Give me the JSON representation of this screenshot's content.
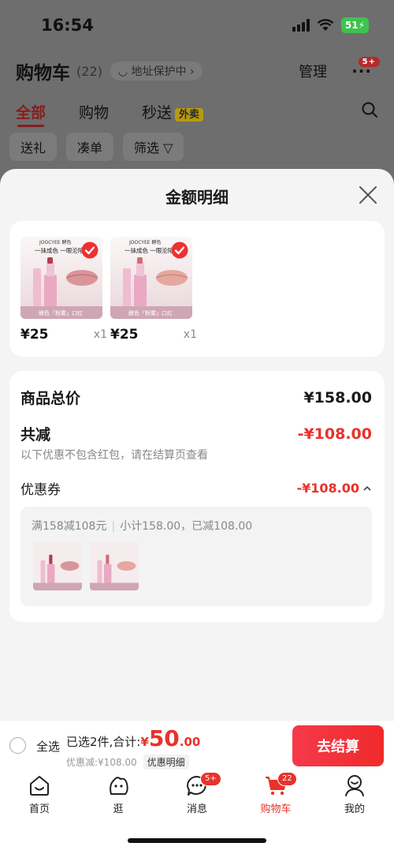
{
  "status": {
    "time": "16:54",
    "battery": "51"
  },
  "header": {
    "title": "购物车",
    "count": "(22)",
    "address_protect": "地址保护中",
    "manage": "管理",
    "more_badge": "5+"
  },
  "tabs": [
    {
      "label": "全部"
    },
    {
      "label": "购物"
    },
    {
      "label": "秒送"
    }
  ],
  "waimai_tag": "外卖",
  "filters": [
    "送礼",
    "凑单",
    "筛选"
  ],
  "sheet": {
    "title": "金额明细",
    "products": [
      {
        "brand": "JOOCYEE 酵色",
        "slogan": "一抹成色 一眼沦陷",
        "caption": "酵色「粉雾」口红",
        "price": "¥25",
        "qty": "x1"
      },
      {
        "brand": "JOOCYEE 酵色",
        "slogan": "一抹成色 一眼沦陷",
        "caption": "酵色「粉雾」口红",
        "price": "¥25",
        "qty": "x1"
      }
    ],
    "total_label": "商品总价",
    "total_value": "¥158.00",
    "reduce_label": "共减",
    "reduce_value": "-¥108.00",
    "reduce_note": "以下优惠不包含红包，请在结算页查看",
    "coupon_label": "优惠券",
    "coupon_value": "-¥108.00",
    "coupon_rule": "满158减108元",
    "coupon_detail": "小计158.00，已减108.00"
  },
  "checkout": {
    "select_all": "全选",
    "summary": "已选2件,合计:",
    "currency": "¥",
    "amount_int": "50",
    "amount_dec": ".00",
    "discount": "优惠减:¥108.00",
    "detail_tag": "优惠明细",
    "pay": "去结算"
  },
  "tabbar": [
    {
      "label": "首页"
    },
    {
      "label": "逛"
    },
    {
      "label": "消息",
      "badge": "5+"
    },
    {
      "label": "购物车",
      "badge": "22"
    },
    {
      "label": "我的"
    }
  ],
  "colors": {
    "accent": "#e8322a",
    "checkout_btn": "#f2343c"
  }
}
